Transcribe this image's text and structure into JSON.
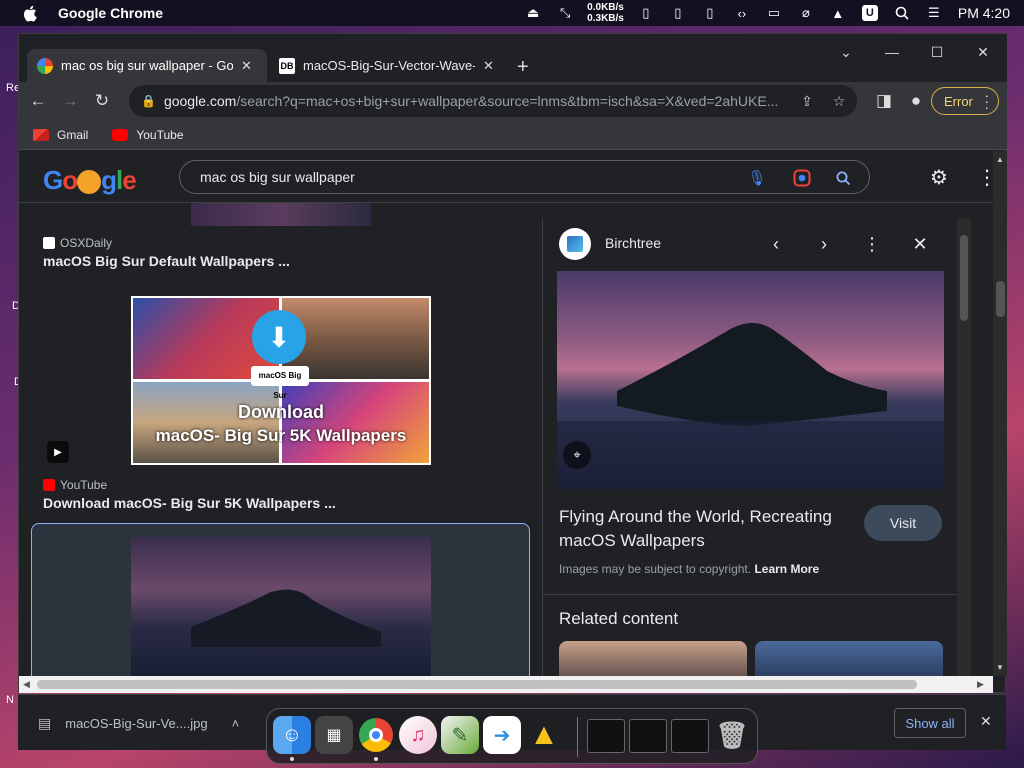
{
  "menubar": {
    "app_name": "Google Chrome",
    "net_up": "0.0KB/s",
    "net_down": "0.3KB/s",
    "clock": "PM 4:20",
    "badge": "U"
  },
  "desktop": {
    "edge_labels": [
      "Re",
      "D",
      "D",
      "N"
    ]
  },
  "tabs": [
    {
      "title": "mac os big sur wallpaper - Goog",
      "favicon": "google-g-icon",
      "active": true
    },
    {
      "title": "macOS-Big-Sur-Vector-Wave-Da",
      "favicon": "db-icon",
      "favicon_text": "DB",
      "active": false
    }
  ],
  "toolbar": {
    "url_host": "google.com",
    "url_rest": "/search?q=mac+os+big+sur+wallpaper&source=lnms&tbm=isch&sa=X&ved=2ahUKE...",
    "error_label": "Error"
  },
  "bookmarks": [
    {
      "label": "Gmail",
      "icon": "gmail-icon"
    },
    {
      "label": "YouTube",
      "icon": "youtube-icon"
    }
  ],
  "search": {
    "query": "mac os big sur wallpaper"
  },
  "results": [
    {
      "source": "OSXDaily",
      "title": "macOS Big Sur Default Wallpapers ..."
    },
    {
      "source": "YouTube",
      "title": "Download macOS- Big Sur 5K Wallpapers ...",
      "thumb_text_1": "Download",
      "thumb_text_2": "macOS- Big Sur 5K Wallpapers",
      "badge_text": "macOS Big Sur"
    }
  ],
  "panel": {
    "source": "Birchtree",
    "title": "Flying Around the World, Recreating macOS Wallpapers",
    "visit_label": "Visit",
    "copyright": "Images may be subject to copyright.",
    "learn_more": "Learn More",
    "related_heading": "Related content"
  },
  "download": {
    "filename": "macOS-Big-Sur-Ve....jpg",
    "show_all": "Show all"
  },
  "colors": {
    "accent_blue": "#8ab4f8",
    "error_yellow": "#f2d57a",
    "bg_dark": "#202124"
  }
}
